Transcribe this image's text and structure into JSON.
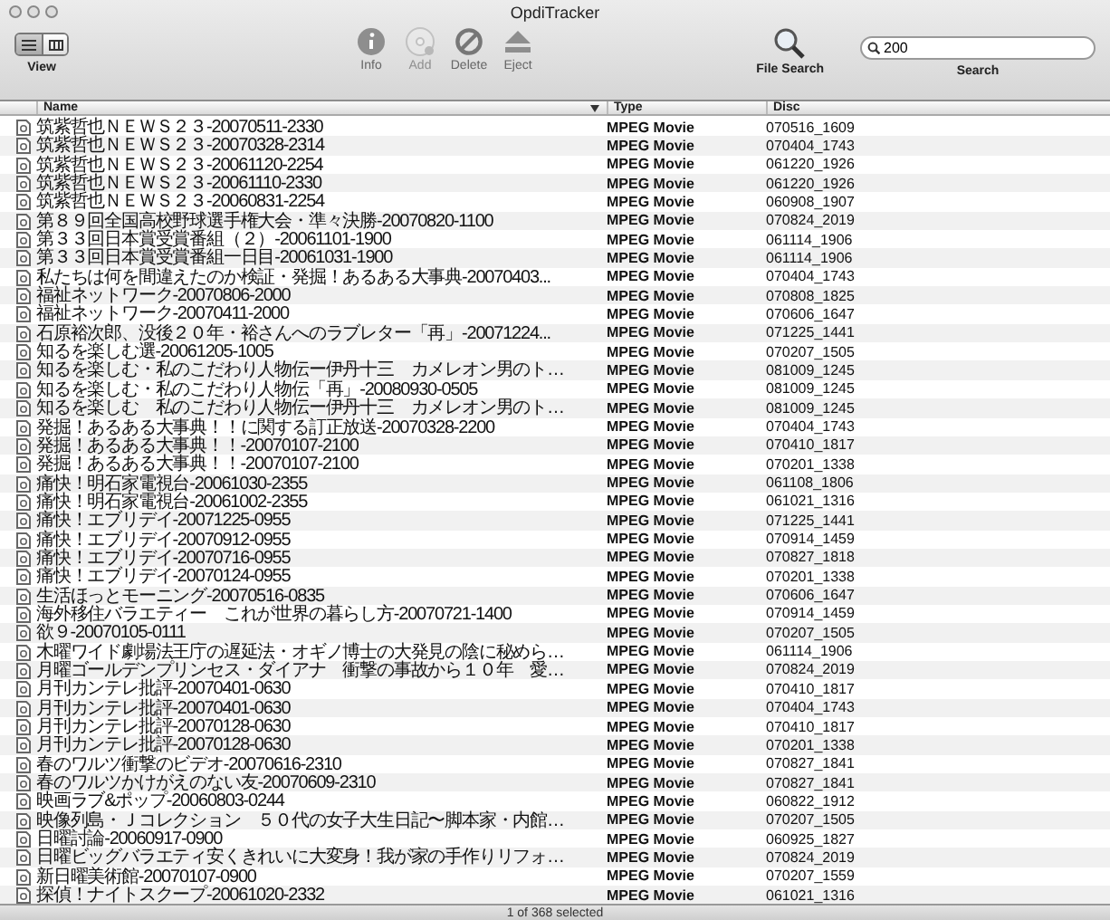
{
  "window": {
    "title": "OpdiTracker"
  },
  "toolbar": {
    "view_label": "View",
    "view_modes": [
      {
        "kind": "list",
        "selected": true
      },
      {
        "kind": "columns",
        "selected": false
      }
    ],
    "actions": [
      {
        "kind": "info",
        "label": "Info",
        "disabled": false
      },
      {
        "kind": "add",
        "label": "Add",
        "disabled": true
      },
      {
        "kind": "delete",
        "label": "Delete",
        "disabled": false
      },
      {
        "kind": "eject",
        "label": "Eject",
        "disabled": false
      }
    ],
    "file_search": {
      "label": "File Search"
    },
    "search": {
      "value": "200",
      "label": "Search"
    }
  },
  "table": {
    "columns": [
      {
        "label": "Name",
        "sorted": true
      },
      {
        "label": "Type",
        "sorted": false
      },
      {
        "label": "Disc",
        "sorted": false
      }
    ],
    "rows": [
      {
        "name": "筑紫哲也ＮＥＷＳ２３-20070511-2330",
        "type": "MPEG Movie",
        "disc": "070516_1609",
        "selected": false
      },
      {
        "name": "筑紫哲也ＮＥＷＳ２３-20070328-2314",
        "type": "MPEG Movie",
        "disc": "070404_1743",
        "selected": false
      },
      {
        "name": "筑紫哲也ＮＥＷＳ２３-20061120-2254",
        "type": "MPEG Movie",
        "disc": "061220_1926",
        "selected": false
      },
      {
        "name": "筑紫哲也ＮＥＷＳ２３-20061110-2330",
        "type": "MPEG Movie",
        "disc": "061220_1926",
        "selected": false
      },
      {
        "name": "筑紫哲也ＮＥＷＳ２３-20060831-2254",
        "type": "MPEG Movie",
        "disc": "060908_1907",
        "selected": false
      },
      {
        "name": "第８９回全国高校野球選手権大会・準々決勝-20070820-1100",
        "type": "MPEG Movie",
        "disc": "070824_2019",
        "selected": false
      },
      {
        "name": "第３３回日本賞受賞番組（２）-20061101-1900",
        "type": "MPEG Movie",
        "disc": "061114_1906",
        "selected": false
      },
      {
        "name": "第３３回日本賞受賞番組一日目-20061031-1900",
        "type": "MPEG Movie",
        "disc": "061114_1906",
        "selected": false
      },
      {
        "name": "私たちは何を間違えたのか検証・発掘！あるある大事典-20070403...",
        "type": "MPEG Movie",
        "disc": "070404_1743",
        "selected": false
      },
      {
        "name": "福祉ネットワーク-20070806-2000",
        "type": "MPEG Movie",
        "disc": "070808_1825",
        "selected": false
      },
      {
        "name": "福祉ネットワーク-20070411-2000",
        "type": "MPEG Movie",
        "disc": "070606_1647",
        "selected": false
      },
      {
        "name": "石原裕次郎、没後２０年・裕さんへのラブレター「再」-20071224...",
        "type": "MPEG Movie",
        "disc": "071225_1441",
        "selected": false
      },
      {
        "name": "知るを楽しむ選-20061205-1005",
        "type": "MPEG Movie",
        "disc": "070207_1505",
        "selected": false
      },
      {
        "name": "知るを楽しむ・私のこだわり人物伝ー伊丹十三　カメレオン男のト…",
        "type": "MPEG Movie",
        "disc": "081009_1245",
        "selected": false
      },
      {
        "name": "知るを楽しむ・私のこだわり人物伝「再」-20080930-0505",
        "type": "MPEG Movie",
        "disc": "081009_1245",
        "selected": false
      },
      {
        "name": "知るを楽しむ　私のこだわり人物伝ー伊丹十三　カメレオン男のト…",
        "type": "MPEG Movie",
        "disc": "081009_1245",
        "selected": false
      },
      {
        "name": "発掘！あるある大事典！！に関する訂正放送-20070328-2200",
        "type": "MPEG Movie",
        "disc": "070404_1743",
        "selected": false
      },
      {
        "name": "発掘！あるある大事典！！-20070107-2100",
        "type": "MPEG Movie",
        "disc": "070410_1817",
        "selected": false
      },
      {
        "name": "発掘！あるある大事典！！-20070107-2100",
        "type": "MPEG Movie",
        "disc": "070201_1338",
        "selected": false
      },
      {
        "name": "痛快！明石家電視台-20061030-2355",
        "type": "MPEG Movie",
        "disc": "061108_1806",
        "selected": false
      },
      {
        "name": "痛快！明石家電視台-20061002-2355",
        "type": "MPEG Movie",
        "disc": "061021_1316",
        "selected": false
      },
      {
        "name": "痛快！エブリデイ-20071225-0955",
        "type": "MPEG Movie",
        "disc": "071225_1441",
        "selected": false
      },
      {
        "name": "痛快！エブリデイ-20070912-0955",
        "type": "MPEG Movie",
        "disc": "070914_1459",
        "selected": false
      },
      {
        "name": "痛快！エブリデイ-20070716-0955",
        "type": "MPEG Movie",
        "disc": "070827_1818",
        "selected": false
      },
      {
        "name": "痛快！エブリデイ-20070124-0955",
        "type": "MPEG Movie",
        "disc": "070201_1338",
        "selected": false
      },
      {
        "name": "生活ほっとモーニング-20070516-0835",
        "type": "MPEG Movie",
        "disc": "070606_1647",
        "selected": false
      },
      {
        "name": "海外移住バラエティー　これが世界の暮らし方-20070721-1400",
        "type": "MPEG Movie",
        "disc": "070914_1459",
        "selected": false
      },
      {
        "name": "欲９-20070105-0111",
        "type": "MPEG Movie",
        "disc": "070207_1505",
        "selected": false
      },
      {
        "name": "木曜ワイド劇場法王庁の遅延法・オギノ博士の大発見の陰に秘めら…",
        "type": "MPEG Movie",
        "disc": "061114_1906",
        "selected": false
      },
      {
        "name": "月曜ゴールデンプリンセス・ダイアナ　衝撃の事故から１０年　愛…",
        "type": "MPEG Movie",
        "disc": "070824_2019",
        "selected": false
      },
      {
        "name": "月刊カンテレ批評-20070401-0630",
        "type": "MPEG Movie",
        "disc": "070410_1817",
        "selected": false
      },
      {
        "name": "月刊カンテレ批評-20070401-0630",
        "type": "MPEG Movie",
        "disc": "070404_1743",
        "selected": false
      },
      {
        "name": "月刊カンテレ批評-20070128-0630",
        "type": "MPEG Movie",
        "disc": "070410_1817",
        "selected": false
      },
      {
        "name": "月刊カンテレ批評-20070128-0630",
        "type": "MPEG Movie",
        "disc": "070201_1338",
        "selected": false
      },
      {
        "name": "春のワルツ衝撃のビデオ-20070616-2310",
        "type": "MPEG Movie",
        "disc": "070827_1841",
        "selected": false
      },
      {
        "name": "春のワルツかけがえのない友-20070609-2310",
        "type": "MPEG Movie",
        "disc": "070827_1841",
        "selected": false
      },
      {
        "name": "映画ラブ&ポップ-20060803-0244",
        "type": "MPEG Movie",
        "disc": "060822_1912",
        "selected": false
      },
      {
        "name": "映像列島・Ｊコレクション　５０代の女子大生日記〜脚本家・内館…",
        "type": "MPEG Movie",
        "disc": "070207_1505",
        "selected": false
      },
      {
        "name": "日曜討論-20060917-0900",
        "type": "MPEG Movie",
        "disc": "060925_1827",
        "selected": false
      },
      {
        "name": "日曜ビッグバラエティ安くきれいに大変身！我が家の手作りリフォ…",
        "type": "MPEG Movie",
        "disc": "070824_2019",
        "selected": false
      },
      {
        "name": "新日曜美術館-20070107-0900",
        "type": "MPEG Movie",
        "disc": "070207_1559",
        "selected": false
      },
      {
        "name": "探偵！ナイトスクープ-20061020-2332",
        "type": "MPEG Movie",
        "disc": "061021_1316",
        "selected": false
      }
    ]
  },
  "status_bar": "1 of 368 selected"
}
